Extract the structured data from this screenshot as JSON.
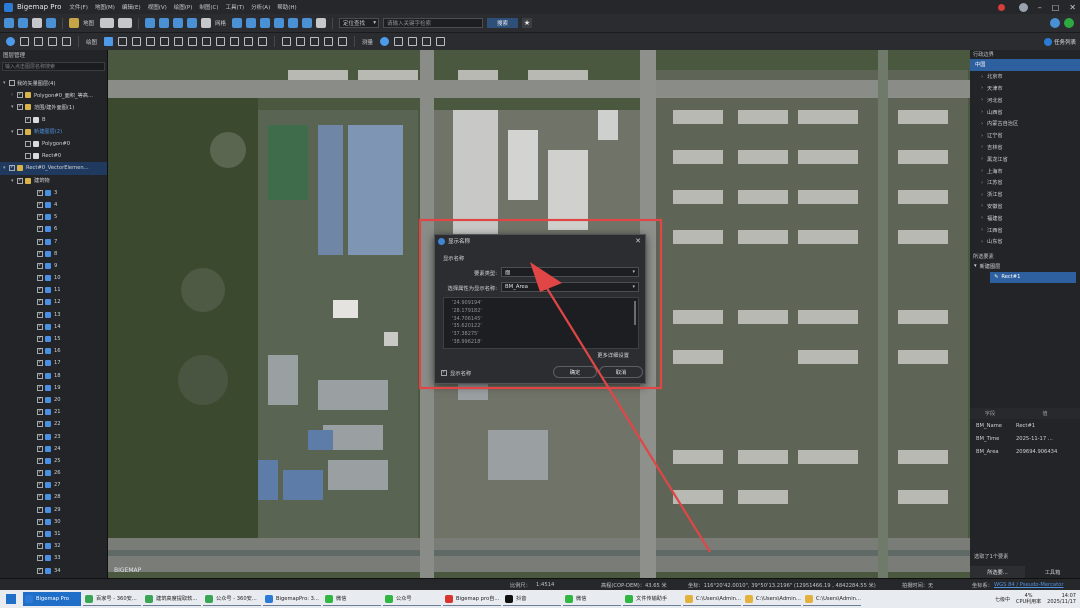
{
  "app": {
    "title": "Bigemap Pro"
  },
  "menu": [
    "文件(F)",
    "地图(M)",
    "编辑(E)",
    "视图(V)",
    "绘图(P)",
    "制图(C)",
    "工具(T)",
    "分析(A)",
    "帮助(H)"
  ],
  "toolbar1": {
    "label_basemap": "地图",
    "label_network": "网格",
    "search_mode": "定位查找",
    "search_placeholder": "请输入关键字检索",
    "search_button": "搜索"
  },
  "toolbar2": {
    "label_draw": "绘图",
    "label_measure": "测量",
    "task_button": "任务列表"
  },
  "layer_panel": {
    "title": "图层管理",
    "search_placeholder": "输入点击图层名称搜索",
    "items": [
      {
        "label": "我的矢量图层(4)",
        "level": 0,
        "arrow": "▾",
        "check": "",
        "icon": "none",
        "style": ""
      },
      {
        "label": "Polygon#0_面积_等高...",
        "level": 1,
        "arrow": "›",
        "check": "✓",
        "icon": "folder",
        "style": ""
      },
      {
        "label": "范围/建外面图(1)",
        "level": 1,
        "arrow": "▾",
        "check": "✓",
        "icon": "folder",
        "style": ""
      },
      {
        "label": "B",
        "level": 2,
        "arrow": "",
        "check": "✓",
        "icon": "file",
        "style": ""
      },
      {
        "label": "新建图层(2)",
        "level": 1,
        "arrow": "▾",
        "check": "",
        "icon": "folder",
        "style": "blue"
      },
      {
        "label": "Polygon#0",
        "level": 2,
        "arrow": "",
        "check": "",
        "icon": "file",
        "style": ""
      },
      {
        "label": "Rect#0",
        "level": 2,
        "arrow": "",
        "check": "",
        "icon": "file",
        "style": ""
      },
      {
        "label": "Rect#0_VectorElemen...",
        "level": 0,
        "arrow": "▾",
        "check": "✓",
        "icon": "folder",
        "style": "selected"
      },
      {
        "label": "建筑物",
        "level": 1,
        "arrow": "▾",
        "check": "✓",
        "icon": "folder",
        "style": ""
      }
    ],
    "numbered": [
      "3",
      "4",
      "5",
      "6",
      "7",
      "8",
      "9",
      "10",
      "11",
      "12",
      "13",
      "14",
      "15",
      "16",
      "17",
      "18",
      "19",
      "20",
      "21",
      "22",
      "23",
      "24",
      "25",
      "26",
      "27",
      "28",
      "29",
      "30",
      "31",
      "32",
      "33",
      "34"
    ]
  },
  "right_panel": {
    "region_title": "行政边界",
    "regions": [
      "中国",
      "北京市",
      "天津市",
      "河北省",
      "山西省",
      "内蒙古自治区",
      "辽宁省",
      "吉林省",
      "黑龙江省",
      "上海市",
      "江苏省",
      "浙江省",
      "安徽省",
      "福建省",
      "江西省",
      "山东省"
    ],
    "selected_title": "所选要素",
    "selected_group": "新建图层",
    "selected_item": "Rect#1",
    "attr_headers": [
      "字段",
      "值"
    ],
    "attributes": [
      {
        "field": "BM_Name",
        "value": "Rect#1"
      },
      {
        "field": "BM_Time",
        "value": "2025-11-17 ..."
      },
      {
        "field": "BM_Area",
        "value": "209694.906434"
      }
    ],
    "selected_count": "选取了1个要素",
    "tabs": [
      "所选要...",
      "工具箱"
    ]
  },
  "dialog": {
    "title": "显示名称",
    "group_label": "显示名称",
    "type_label": "要素类型:",
    "type_value": "面",
    "attr_label": "选择属性为显示名称:",
    "attr_value": "BM_Area",
    "values": [
      "'24.909194'",
      "'28.179182'",
      "'34.706145'",
      "'35.620122'",
      "'37.38275'",
      "'38.996218'"
    ],
    "more_settings": "更多详细设置",
    "show_name_label": "显示名称",
    "show_name_checked": true,
    "ok": "确定",
    "cancel": "取消"
  },
  "map": {
    "logo_text": "BIGEMAP"
  },
  "statusbar": {
    "scale_label": "比例尺：",
    "scale_value": "1:4514",
    "elevation": "高程(COP-DEM)：43.65 米",
    "coords": "坐标：116°20'42.0010\", 39°50'13.2196\"  (12951466.19 , 4842284.55 米)",
    "elapsed": "拍摄时间：无",
    "crs_label": "坐标系：",
    "crs_value": "WGS 84 / Pseudo-Mercator"
  },
  "taskbar": {
    "tasks": [
      {
        "label": "Bigemap Pro",
        "color": "#2b7bd6",
        "state": "active"
      },
      {
        "label": "百家号 - 360安...",
        "color": "#3aa655",
        "state": "running"
      },
      {
        "label": "建筑高度提取软...",
        "color": "#3aa655",
        "state": "running"
      },
      {
        "label": "公众号 - 360安...",
        "color": "#3aa655",
        "state": "running"
      },
      {
        "label": "BigemapPro: 3...",
        "color": "#2b7bd6",
        "state": "running"
      },
      {
        "label": "微信",
        "color": "#2fb742",
        "state": "running"
      },
      {
        "label": "公众号",
        "color": "#2fb742",
        "state": "running"
      },
      {
        "label": "Bigemap pro自...",
        "color": "#d9352f",
        "state": "running"
      },
      {
        "label": "抖音",
        "color": "#111111",
        "state": "running"
      },
      {
        "label": "微信",
        "color": "#2fb742",
        "state": "running"
      },
      {
        "label": "文件传输助手",
        "color": "#2fb742",
        "state": "running"
      },
      {
        "label": "C:\\Users\\Admin...",
        "color": "#e2b23c",
        "state": "running"
      },
      {
        "label": "C:\\Users\\Admin...",
        "color": "#e2b23c",
        "state": "running"
      },
      {
        "label": "C:\\Users\\Admin...",
        "color": "#e2b23c",
        "state": "running"
      }
    ],
    "tray_weather": "七级中",
    "cpu_percent": "4%",
    "cpu_label": "CPU利用率",
    "time": "14:07",
    "date": "2025/11/17"
  },
  "colors": {
    "highlight": "#e04646",
    "accent": "#2b7bd6"
  }
}
